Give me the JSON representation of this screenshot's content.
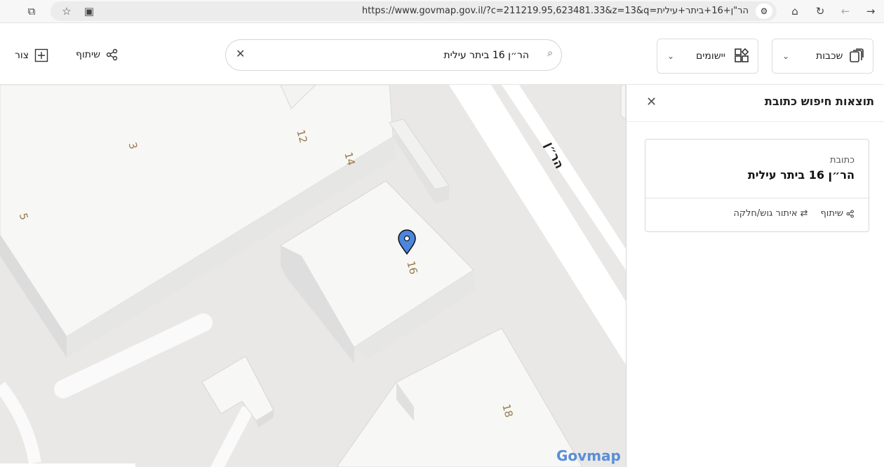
{
  "browser": {
    "url": "https://www.govmap.gov.il/?c=211219.95,623481.33&z=13&q=הר\"ן+16+ביתר+עילית"
  },
  "header": {
    "layers_label": "שכבות",
    "apps_label": "יישומים",
    "search_value": "הר״ן 16 ביתר עילית",
    "share_label": "שיתוף",
    "draw_label": "צור"
  },
  "map": {
    "street_name": "הר״ן",
    "building_numbers": [
      "3",
      "5",
      "12",
      "14",
      "16",
      "18"
    ],
    "logo": "Govmap"
  },
  "panel": {
    "title": "תוצאות חיפוש כתובת",
    "card": {
      "label": "כתובת",
      "value": "הר״ן 16 ביתר עילית",
      "action_parcel": "איתור גוש/חלקה",
      "action_share": "שיתוף"
    }
  },
  "colors": {
    "pin": "#4a86e0",
    "map_bg": "#e9e8e6",
    "building": "#f7f7f6",
    "house_number": "#9a7b4a"
  }
}
